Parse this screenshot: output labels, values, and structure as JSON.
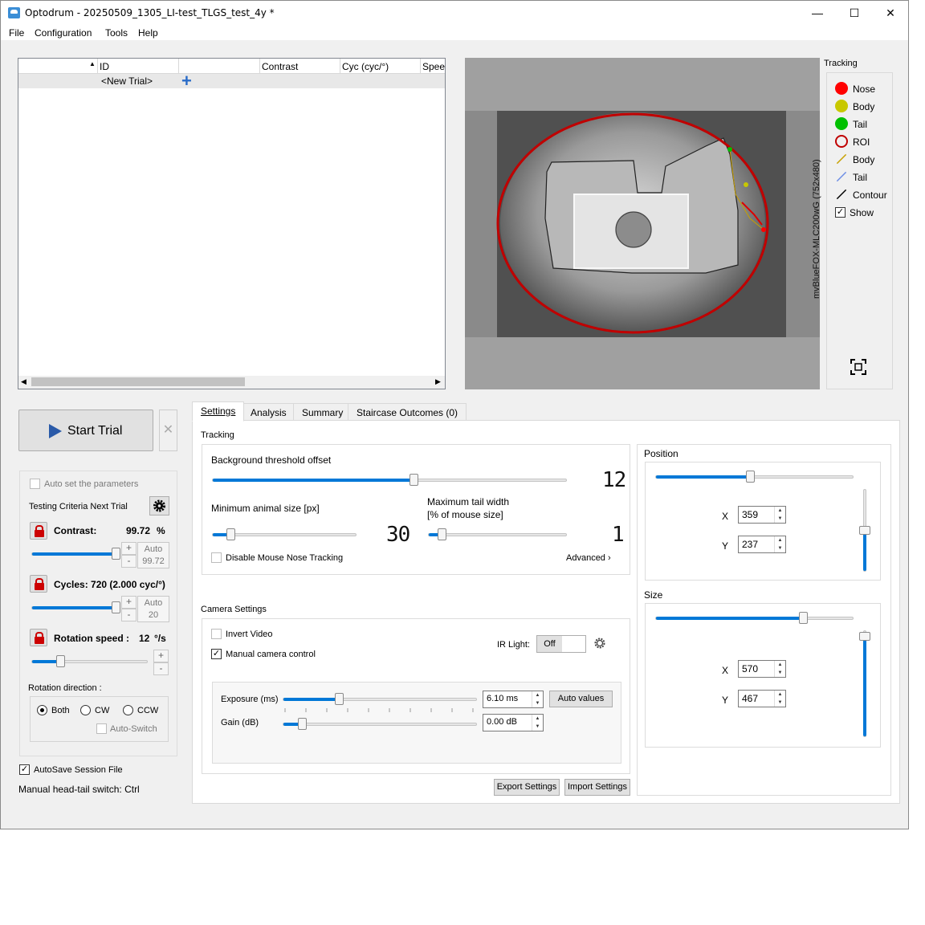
{
  "window": {
    "title": "Optodrum - 20250509_1305_LI-test_TLGS_test_4y *",
    "minimize": "—",
    "maximize": "☐",
    "close": "✕"
  },
  "menu": [
    "File",
    "Configuration",
    "Tools",
    "Help"
  ],
  "trials_table": {
    "columns": [
      "ID",
      "",
      "Contrast",
      "Cyc (cyc/°)",
      "Speed"
    ],
    "new_trial_label": "<New Trial>",
    "add_icon": "+"
  },
  "video": {
    "camera_label": "mvBlueFOX-MLC200wG (752x480)"
  },
  "tracking_legend": {
    "title": "Tracking",
    "items": [
      {
        "label": "Nose",
        "color": "#ff0000",
        "kind": "dot"
      },
      {
        "label": "Body",
        "color": "#c8c800",
        "kind": "dot"
      },
      {
        "label": "Tail",
        "color": "#00c000",
        "kind": "dot"
      },
      {
        "label": "ROI",
        "color": "#c00000",
        "kind": "ring"
      },
      {
        "label": "Body",
        "color": "#c8a000",
        "kind": "line"
      },
      {
        "label": "Tail",
        "color": "#6e8ee6",
        "kind": "line"
      },
      {
        "label": "Contour",
        "color": "#000000",
        "kind": "line"
      }
    ],
    "show_label": "Show",
    "show_checked": true
  },
  "start_trial": {
    "label": "Start Trial",
    "cancel": "✕"
  },
  "criteria": {
    "auto_set_label": "Auto set the parameters",
    "heading": "Testing Criteria Next Trial",
    "contrast": {
      "label": "Contrast:",
      "value": "99.72",
      "unit": "%",
      "auto": "Auto",
      "auto_value": "99.72",
      "level": 0.97
    },
    "cycles": {
      "label": "Cycles: 720 (2.000 cyc/°)",
      "auto": "Auto",
      "auto_value": "20",
      "level": 0.97
    },
    "rotation": {
      "label": "Rotation speed :",
      "value": "12",
      "unit": "°/s",
      "level": 0.25
    },
    "plus": "+",
    "minus": "-",
    "direction_label": "Rotation direction :",
    "directions": [
      "Both",
      "CW",
      "CCW"
    ],
    "selected_direction": "Both",
    "auto_switch": "Auto-Switch"
  },
  "autosave": {
    "label": "AutoSave Session File",
    "checked": true
  },
  "manual_switch": "Manual head-tail switch: Ctrl",
  "tabs": [
    "Settings",
    "Analysis",
    "Summary",
    "Staircase Outcomes (0)"
  ],
  "active_tab": "Settings",
  "settings": {
    "tracking_title": "Tracking",
    "bg_threshold": {
      "label": "Background threshold offset",
      "value": "12",
      "level": 0.57
    },
    "min_animal": {
      "label": "Minimum animal size [px]",
      "value": "30",
      "level": 0.13
    },
    "max_tail": {
      "label_line1": "Maximum tail width",
      "label_line2": "[% of mouse size]",
      "value": "1",
      "level": 0.1
    },
    "disable_nose": "Disable Mouse Nose Tracking",
    "advanced": "Advanced ›",
    "camera_title": "Camera Settings",
    "invert_video": "Invert Video",
    "manual_camera": "Manual camera control",
    "ir_light_label": "IR Light:",
    "ir_light_state": "Off",
    "exposure": {
      "label": "Exposure (ms)",
      "value": "6.10 ms",
      "level": 0.29
    },
    "auto_values": "Auto values",
    "gain": {
      "label": "Gain (dB)",
      "value": "0.00 dB",
      "level": 0.1
    },
    "export": "Export Settings",
    "import": "Import Settings"
  },
  "position": {
    "title": "Position",
    "x_label": "X",
    "x": "359",
    "y_label": "Y",
    "y": "237",
    "h_level": 0.48,
    "v_level": 0.5
  },
  "size": {
    "title": "Size",
    "x_label": "X",
    "x": "570",
    "y_label": "Y",
    "y": "467",
    "h_level": 0.75,
    "v_level": 0.95
  }
}
